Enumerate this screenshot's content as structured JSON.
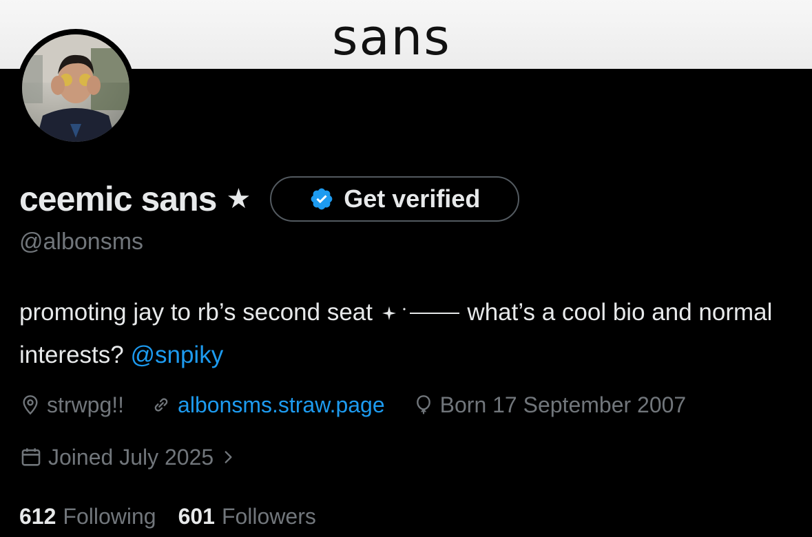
{
  "banner": {
    "text": "sans"
  },
  "profile": {
    "display_name": "ceemic sans",
    "name_badge_icon": "star-icon",
    "handle": "@albonsms",
    "verify_button": {
      "label": "Get verified",
      "icon": "verified-badge-icon",
      "icon_color": "#1d9bf0"
    }
  },
  "bio": {
    "part1": "promoting jay to rb’s second seat ",
    "part2": " what’s a cool bio and normal interests? ",
    "mention": "@snpiky"
  },
  "meta": {
    "location": "strwpg!!",
    "website": "albonsms.straw.page",
    "birthday": "Born 17 September 2007",
    "joined": "Joined July 2025"
  },
  "stats": {
    "following_count": "612",
    "following_label": "Following",
    "followers_count": "601",
    "followers_label": "Followers"
  },
  "colors": {
    "background": "#000000",
    "text_primary": "#e7e9ea",
    "text_secondary": "#71767b",
    "accent": "#1d9bf0"
  }
}
